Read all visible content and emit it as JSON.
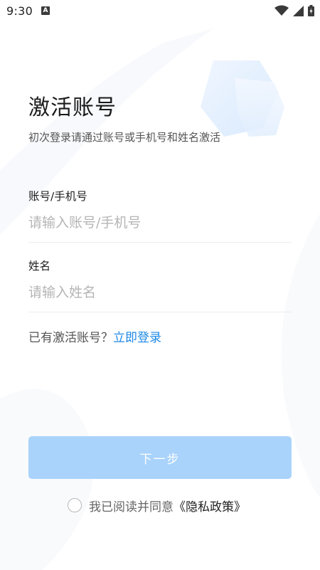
{
  "status_bar": {
    "time": "9:30",
    "notification_icon": "A"
  },
  "page": {
    "title": "激活账号",
    "subtitle": "初次登录请通过账号或手机号和姓名激活"
  },
  "form": {
    "account": {
      "label": "账号/手机号",
      "placeholder": "请输入账号/手机号",
      "value": ""
    },
    "name": {
      "label": "姓名",
      "placeholder": "请输入姓名",
      "value": ""
    }
  },
  "login": {
    "prompt": "已有激活账号？",
    "link": "立即登录"
  },
  "next_button": {
    "label": "下一步"
  },
  "agreement": {
    "text": "我已阅读并同意",
    "link": "《隐私政策》",
    "checked": false
  },
  "colors": {
    "accent": "#1e88e5",
    "button_disabled": "#a9d3fb",
    "placeholder": "#b5b5b5",
    "divider": "#ececec"
  }
}
